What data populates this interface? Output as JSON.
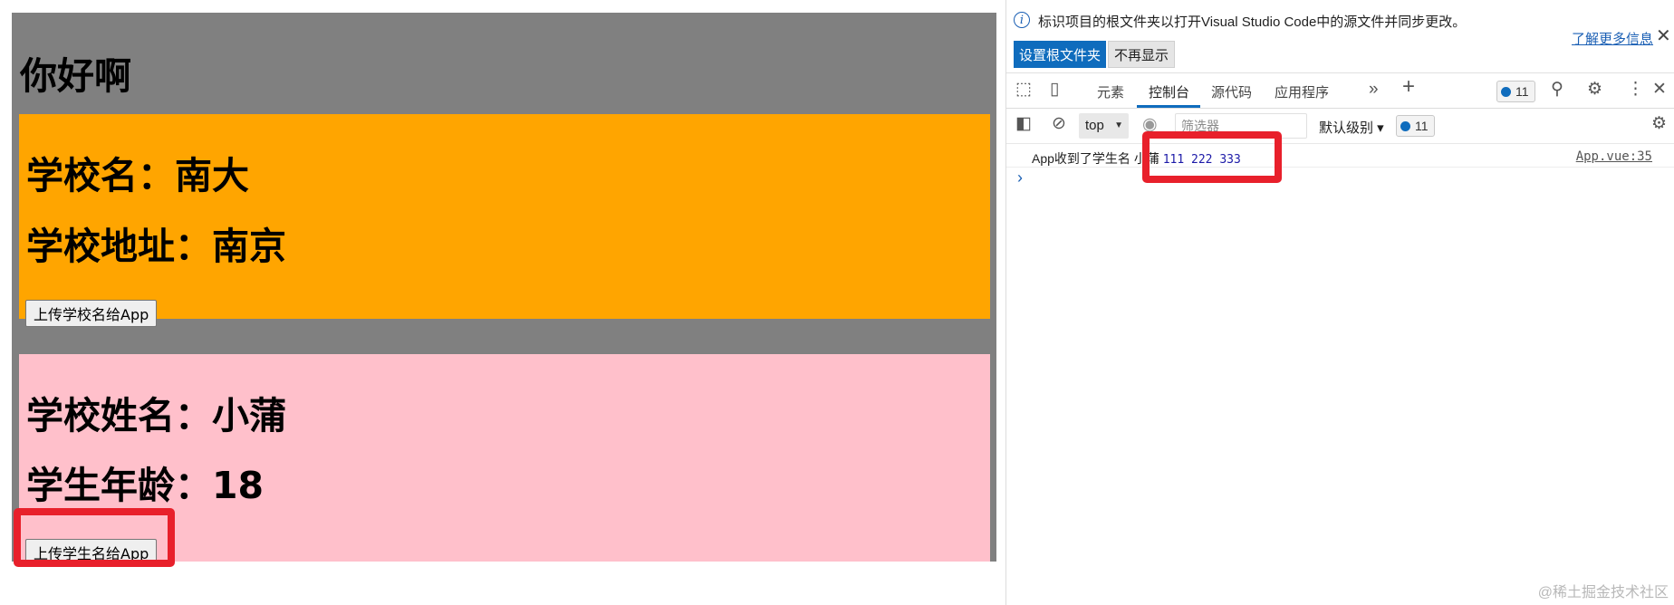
{
  "page": {
    "title": "你好啊",
    "school": {
      "name_line": "学校名：南大",
      "address_line": "学校地址：南京",
      "button_label": "上传学校名给App"
    },
    "student": {
      "name_line": "学校姓名：小蒲",
      "age_line": "学生年龄：18",
      "button_label": "上传学生名给App"
    }
  },
  "devtools": {
    "infobar": {
      "message": "标识项目的根文件夹以打开Visual Studio Code中的源文件并同步更改。",
      "learn_more": "了解更多信息",
      "set_root_button": "设置根文件夹",
      "dont_show_button": "不再显示"
    },
    "tabs": [
      {
        "label": "元素"
      },
      {
        "label": "控制台"
      },
      {
        "label": "源代码"
      },
      {
        "label": "应用程序"
      }
    ],
    "active_tab": "控制台",
    "issues_count": "11",
    "toolbar": {
      "context": "top",
      "filter_placeholder": "筛选器",
      "level": "默认级别",
      "message_count": "11"
    },
    "console": {
      "message_prefix": "App收到了学生名",
      "message_name": "小蒲",
      "message_numbers": "111 222 333",
      "source": "App.vue:35"
    }
  },
  "watermark": "@稀土掘金技术社区",
  "colors": {
    "app_background": "#808080",
    "school_panel": "#ffa500",
    "student_panel": "#ffc0cb",
    "highlight": "#e8202b",
    "accent": "#0f6cbd"
  }
}
